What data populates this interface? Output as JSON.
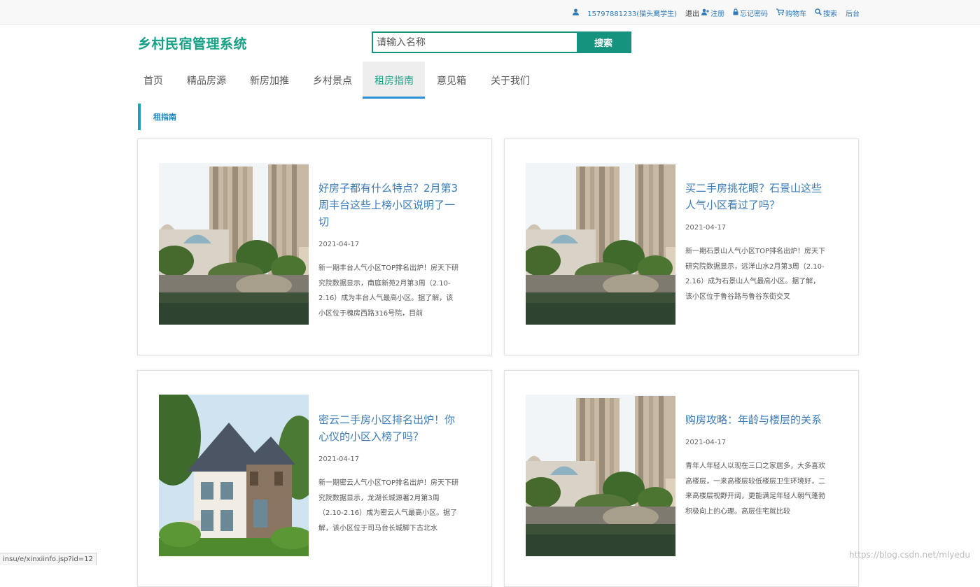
{
  "topbar": {
    "user": "15797881233(猫头鹰学生)",
    "logout": "退出",
    "register": "注册",
    "forgot": "忘记密码",
    "cart": "购物车",
    "search": "搜索",
    "admin": "后台"
  },
  "header": {
    "brand": "乡村民宿管理系统",
    "search_placeholder": "请输入名称",
    "search_button": "搜索"
  },
  "nav": {
    "items": [
      "首页",
      "精品房源",
      "新房加推",
      "乡村景点",
      "租房指南",
      "意见箱",
      "关于我们"
    ],
    "active": "租房指南"
  },
  "section": {
    "title": "租指南"
  },
  "cards": [
    {
      "title": "好房子都有什么特点？2月第3周丰台这些上榜小区说明了一切",
      "date": "2021-04-17",
      "desc": "新一期丰台人气小区TOP排名出炉！房天下研究院数据显示，南庭新苑2月第3周（2.10-2.16）成为丰台人气最高小区。据了解，该小区位于槐房西路316号院，目前"
    },
    {
      "title": "买二手房挑花眼？石景山这些人气小区看过了吗？",
      "date": "2021-04-17",
      "desc": "新一期石景山人气小区TOP排名出炉！房天下研究院数据显示，远洋山水2月第3周（2.10-2.16）成为石景山人气最高小区。据了解，该小区位于鲁谷路与鲁谷东街交叉"
    },
    {
      "title": "密云二手房小区排名出炉！你心仪的小区入榜了吗？",
      "date": "2021-04-17",
      "desc": "新一期密云人气小区TOP排名出炉！房天下研究院数据显示，龙湖长城源著2月第3周（2.10-2.16）成为密云人气最高小区。据了解，该小区位于司马台长城脚下古北水"
    },
    {
      "title": "购房攻略：年龄与楼层的关系",
      "date": "2021-04-17",
      "desc": "青年人年轻人以现在三口之家居多，大多喜欢高楼层，一来高楼层较低楼层卫生环境好，二来高楼层视野开阔，更能满足年轻人朝气蓬勃积极向上的心理。高层住宅就比较"
    }
  ],
  "status": {
    "url": "insu/e/xinxiinfo.jsp?id=12"
  },
  "watermark": "https://blog.csdn.net/mlyedu",
  "colors": {
    "brand": "#16a085",
    "accent": "#16937f",
    "link": "#3a7bb8",
    "active_border": "#2a8fd4"
  }
}
